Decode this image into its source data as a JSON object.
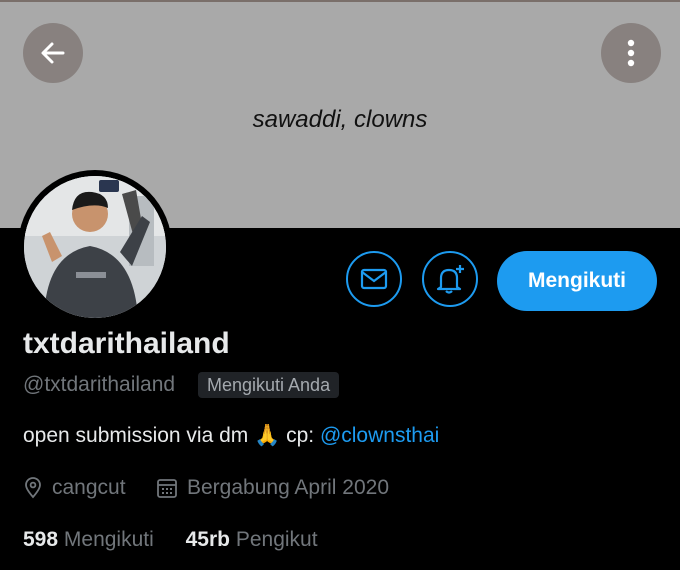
{
  "banner": {
    "text": "sawaddi, clowns"
  },
  "header": {
    "back_icon": "arrow-left-icon",
    "more_icon": "more-vertical-icon"
  },
  "actions": {
    "mail_icon": "envelope-icon",
    "bell_icon": "bell-plus-icon",
    "follow_label": "Mengikuti"
  },
  "profile": {
    "name": "txtdarithailand",
    "handle": "@txtdarithailand",
    "follows_you": "Mengikuti Anda",
    "bio_text": "open submission via dm 🙏  cp:",
    "bio_link": "@clownsthai",
    "location": "cangcut",
    "joined": "Bergabung April 2020",
    "following_count": "598",
    "following_label": "Mengikuti",
    "followers_count": "45rb",
    "followers_label": "Pengikut"
  },
  "colors": {
    "accent": "#1d9bf0",
    "banner": "#a9a9a9",
    "background": "#000000"
  }
}
